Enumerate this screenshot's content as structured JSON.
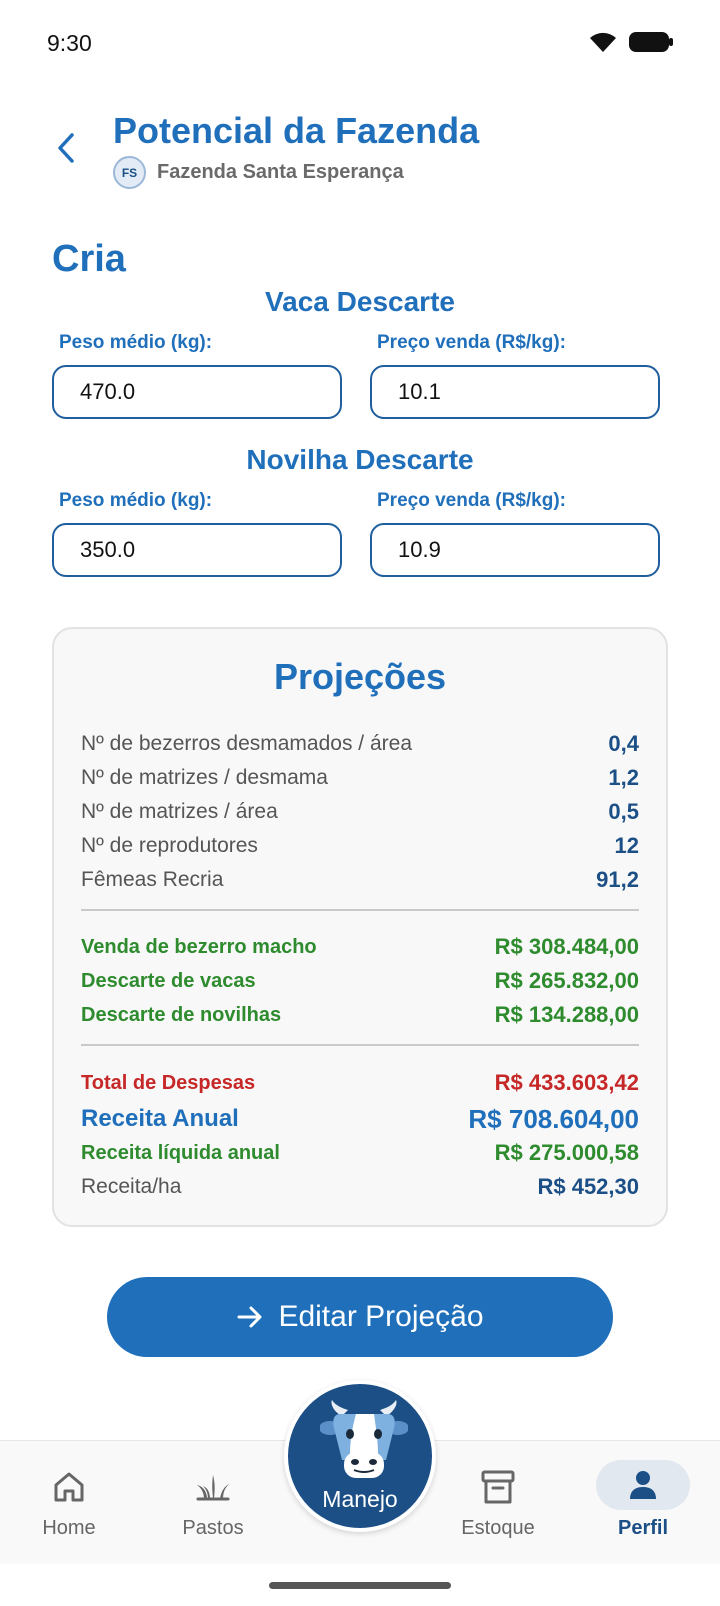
{
  "status_bar": {
    "time": "9:30"
  },
  "header": {
    "title": "Potencial da Fazenda",
    "farm_initials": "FS",
    "farm_name": "Fazenda Santa Esperança"
  },
  "section": {
    "title": "Cria"
  },
  "groups": [
    {
      "title": "Vaca Descarte",
      "weight_label": "Peso médio (kg):",
      "weight_value": "470.0",
      "price_label": "Preço venda (R$/kg):",
      "price_value": "10.1"
    },
    {
      "title": "Novilha Descarte",
      "weight_label": "Peso médio (kg):",
      "weight_value": "350.0",
      "price_label": "Preço venda (R$/kg):",
      "price_value": "10.9"
    }
  ],
  "projections": {
    "title": "Projeções",
    "stats": [
      {
        "label": "Nº de bezerros desmamados / área",
        "value": "0,4"
      },
      {
        "label": "Nº de matrizes / desmama",
        "value": "1,2"
      },
      {
        "label": "Nº de matrizes / área",
        "value": "0,5"
      },
      {
        "label": "Nº de reprodutores",
        "value": "12"
      },
      {
        "label": "Fêmeas Recria",
        "value": "91,2"
      }
    ],
    "revenues": [
      {
        "label": "Venda de bezerro macho",
        "value": "R$ 308.484,00"
      },
      {
        "label": "Descarte de vacas",
        "value": "R$ 265.832,00"
      },
      {
        "label": "Descarte de novilhas",
        "value": "R$ 134.288,00"
      }
    ],
    "totals": {
      "expenses_label": "Total de Despesas",
      "expenses_value": "R$ 433.603,42",
      "annual_revenue_label": "Receita Anual",
      "annual_revenue_value": "R$ 708.604,00",
      "net_revenue_label": "Receita líquida anual",
      "net_revenue_value": "R$ 275.000,58",
      "revenue_per_ha_label": "Receita/ha",
      "revenue_per_ha_value": "R$ 452,30"
    }
  },
  "edit_button": {
    "label": "Editar Projeção",
    "icon": "arrow-right-icon"
  },
  "bottom_nav": {
    "items": [
      {
        "label": "Home",
        "icon": "home-icon"
      },
      {
        "label": "Pastos",
        "icon": "grass-icon"
      },
      {
        "label": "Manejo",
        "icon": "cow-icon"
      },
      {
        "label": "Estoque",
        "icon": "archive-box-icon"
      },
      {
        "label": "Perfil",
        "icon": "person-icon",
        "active": true
      }
    ]
  },
  "colors": {
    "primary": "#1f6fbb",
    "dark_blue": "#1b4f86",
    "green": "#2e8b2e",
    "red": "#c62828"
  }
}
